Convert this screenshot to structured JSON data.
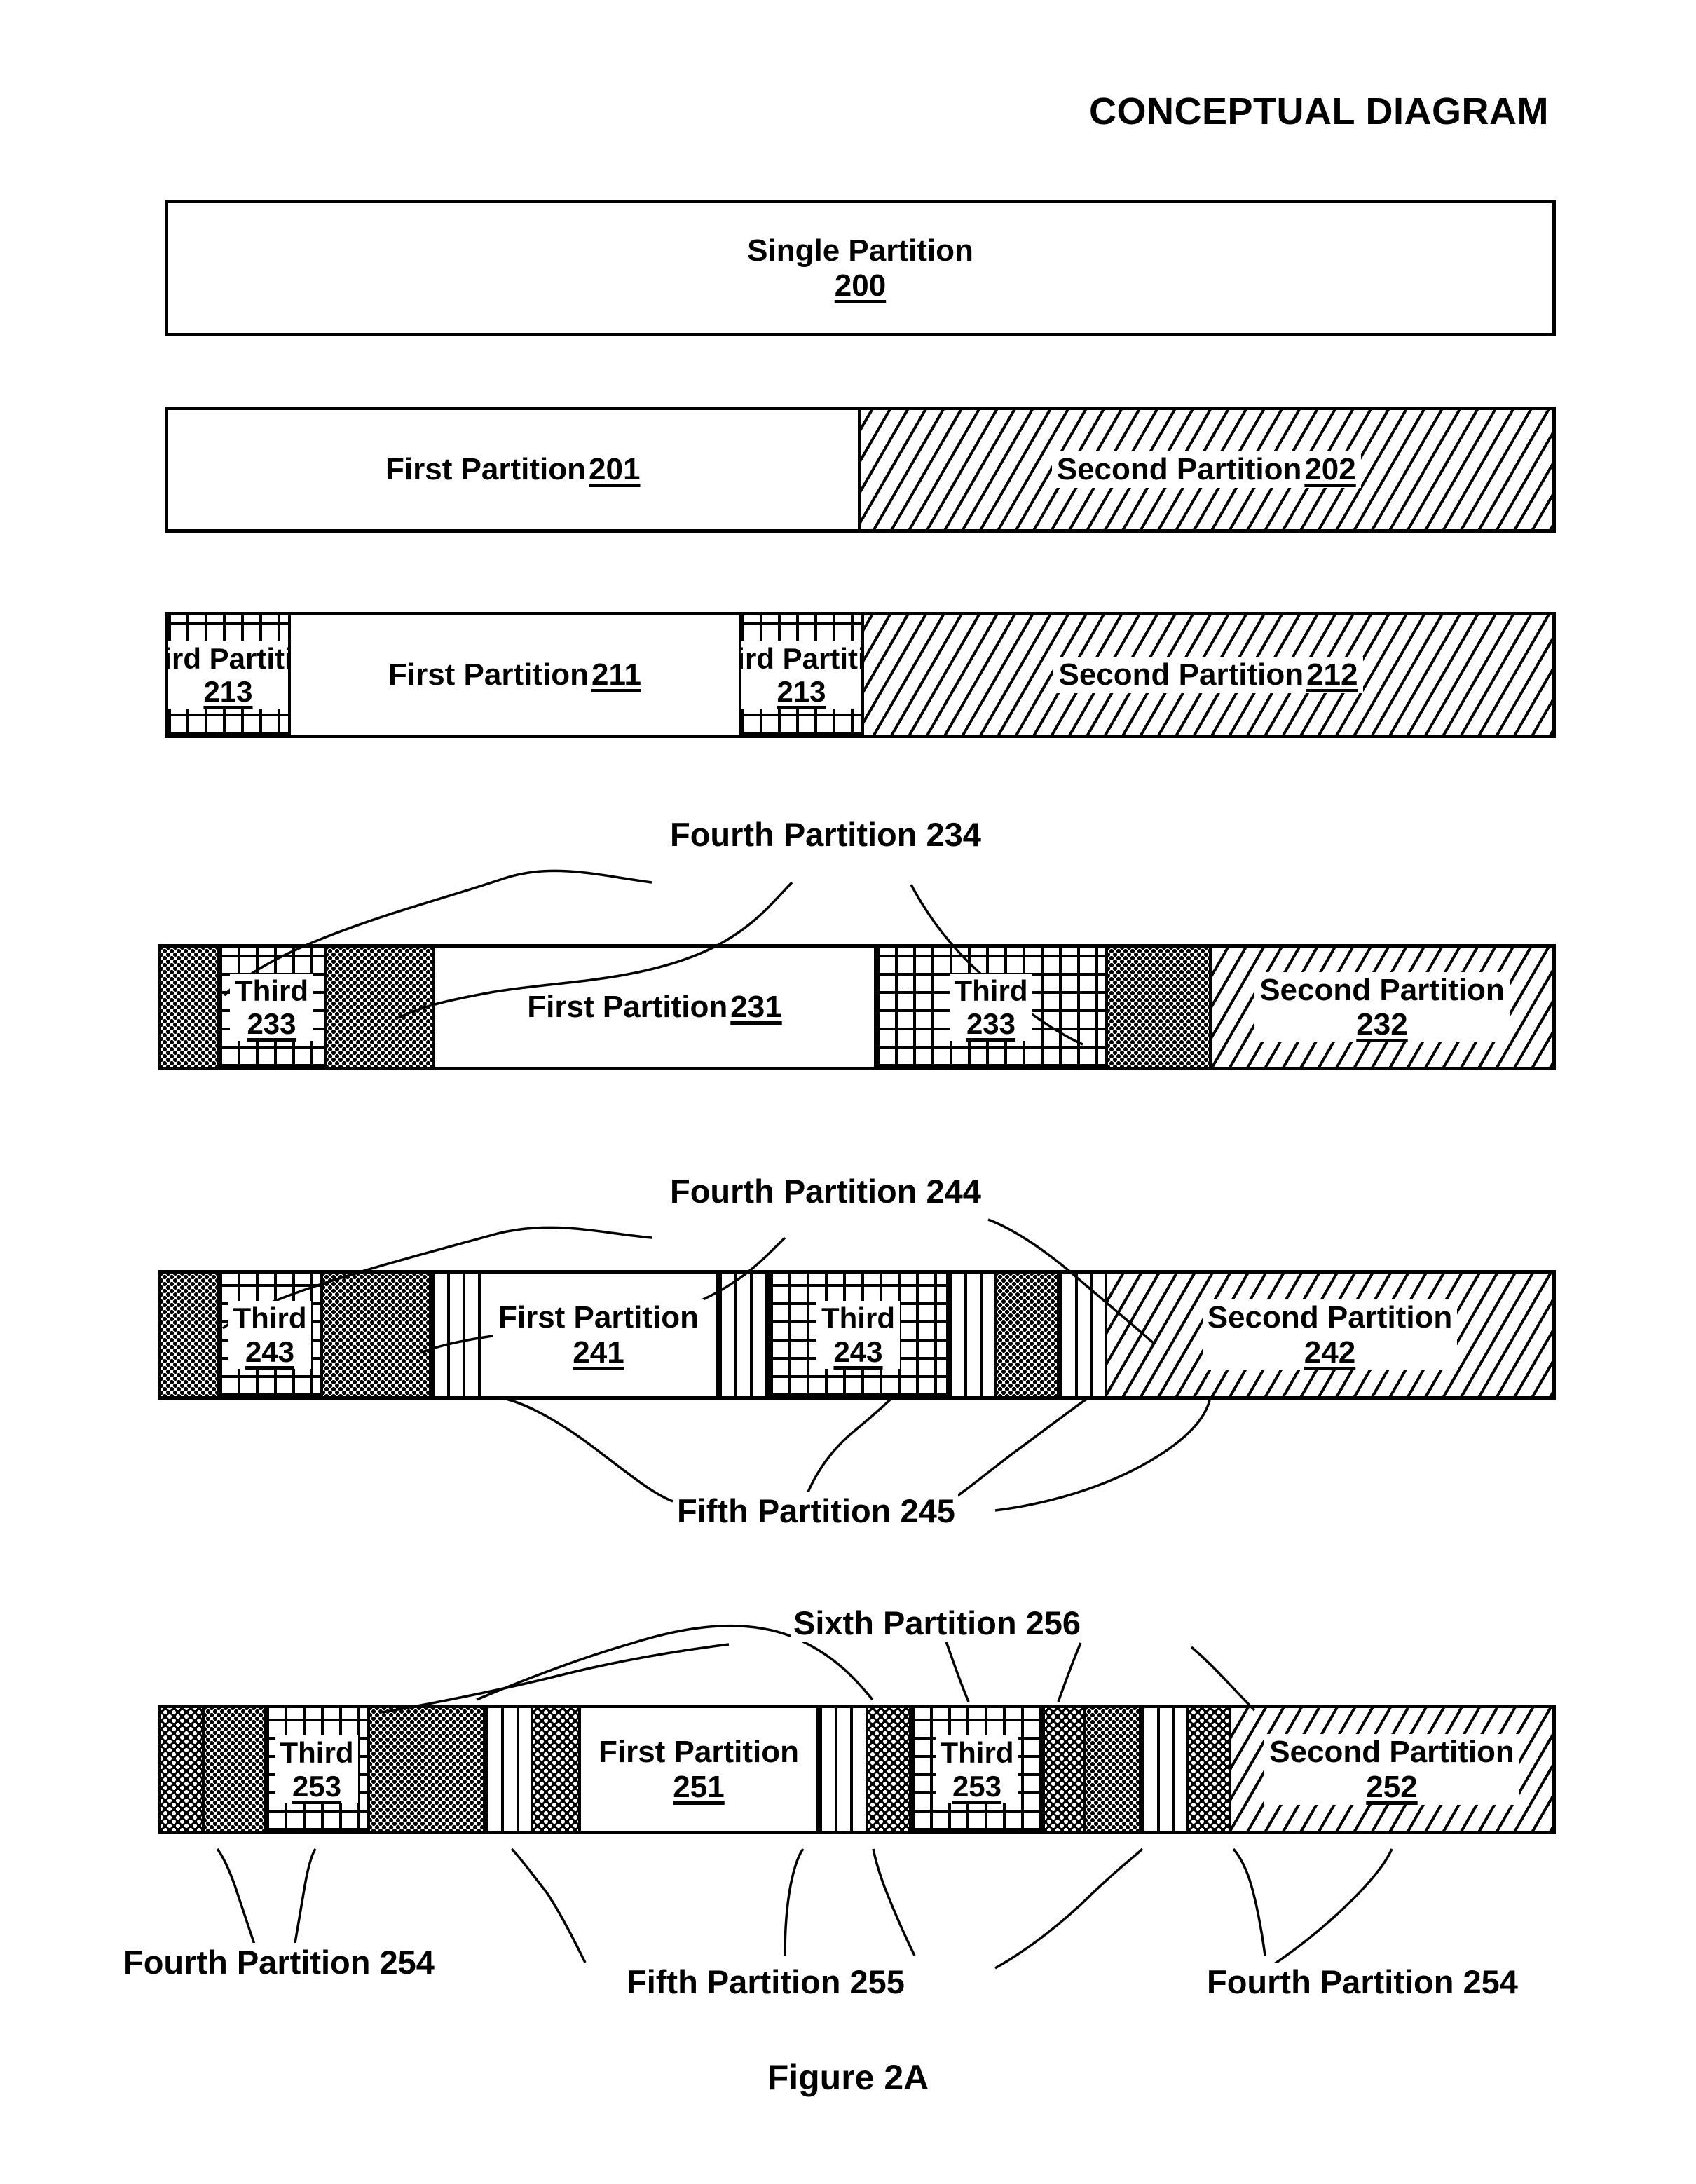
{
  "header": {
    "title": "CONCEPTUAL DIAGRAM"
  },
  "figure": {
    "caption": "Figure 2A"
  },
  "rows": [
    {
      "id": "row-1",
      "segments": [
        {
          "name": "single-partition",
          "label": "Single Partition",
          "num": "200",
          "layout": "stacked",
          "pattern": "none"
        }
      ]
    },
    {
      "id": "row-2",
      "segments": [
        {
          "name": "first-partition",
          "label": "First Partition",
          "num": "201",
          "layout": "inline",
          "pattern": "none"
        },
        {
          "name": "second-partition",
          "label": "Second Partition",
          "num": "202",
          "layout": "inline",
          "pattern": "diagonal"
        }
      ]
    },
    {
      "id": "row-3",
      "segments": [
        {
          "name": "third-partition",
          "label": "Third Partition",
          "num": "213",
          "layout": "stacked",
          "pattern": "grid"
        },
        {
          "name": "first-partition",
          "label": "First Partition",
          "num": "211",
          "layout": "inline",
          "pattern": "none"
        },
        {
          "name": "third-partition",
          "label": "Third Partition",
          "num": "213",
          "layout": "stacked",
          "pattern": "grid"
        },
        {
          "name": "second-partition",
          "label": "Second Partition",
          "num": "212",
          "layout": "inline",
          "pattern": "diagonal"
        }
      ]
    },
    {
      "id": "row-4",
      "segments": [
        {
          "name": "fourth-partition",
          "label": "",
          "num": "",
          "layout": "none",
          "pattern": "dots"
        },
        {
          "name": "third-partition",
          "label": "Third",
          "num": "233",
          "layout": "stacked",
          "pattern": "grid"
        },
        {
          "name": "fourth-partition",
          "label": "",
          "num": "",
          "layout": "none",
          "pattern": "dots"
        },
        {
          "name": "first-partition",
          "label": "First Partition",
          "num": "231",
          "layout": "inline",
          "pattern": "none"
        },
        {
          "name": "third-partition",
          "label": "Third",
          "num": "233",
          "layout": "stacked",
          "pattern": "grid"
        },
        {
          "name": "fourth-partition",
          "label": "",
          "num": "",
          "layout": "none",
          "pattern": "dots"
        },
        {
          "name": "second-partition",
          "label": "Second Partition",
          "num": "232",
          "layout": "stacked",
          "pattern": "diagonal"
        }
      ]
    },
    {
      "id": "row-5",
      "segments": [
        {
          "name": "fourth-partition",
          "label": "",
          "num": "",
          "layout": "none",
          "pattern": "dots"
        },
        {
          "name": "third-partition",
          "label": "Third",
          "num": "243",
          "layout": "stacked",
          "pattern": "grid"
        },
        {
          "name": "fourth-partition",
          "label": "",
          "num": "",
          "layout": "none",
          "pattern": "dots"
        },
        {
          "name": "fifth-partition",
          "label": "",
          "num": "",
          "layout": "none",
          "pattern": "vertical"
        },
        {
          "name": "first-partition",
          "label": "First Partition",
          "num": "241",
          "layout": "stacked",
          "pattern": "none"
        },
        {
          "name": "fifth-partition",
          "label": "",
          "num": "",
          "layout": "none",
          "pattern": "vertical"
        },
        {
          "name": "third-partition",
          "label": "Third",
          "num": "243",
          "layout": "stacked",
          "pattern": "grid"
        },
        {
          "name": "fifth-partition",
          "label": "",
          "num": "",
          "layout": "none",
          "pattern": "vertical"
        },
        {
          "name": "fourth-partition",
          "label": "",
          "num": "",
          "layout": "none",
          "pattern": "dots"
        },
        {
          "name": "fifth-partition",
          "label": "",
          "num": "",
          "layout": "none",
          "pattern": "vertical"
        },
        {
          "name": "second-partition",
          "label": "Second Partition",
          "num": "242",
          "layout": "stacked",
          "pattern": "diagonal"
        }
      ]
    },
    {
      "id": "row-6",
      "segments": [
        {
          "name": "sixth-partition",
          "label": "",
          "num": "",
          "layout": "none",
          "pattern": "dark"
        },
        {
          "name": "fourth-partition",
          "label": "",
          "num": "",
          "layout": "none",
          "pattern": "dots"
        },
        {
          "name": "third-partition",
          "label": "Third",
          "num": "253",
          "layout": "stacked",
          "pattern": "grid"
        },
        {
          "name": "fourth-partition",
          "label": "",
          "num": "",
          "layout": "none",
          "pattern": "dots"
        },
        {
          "name": "fifth-partition",
          "label": "",
          "num": "",
          "layout": "none",
          "pattern": "vertical"
        },
        {
          "name": "sixth-partition",
          "label": "",
          "num": "",
          "layout": "none",
          "pattern": "dark"
        },
        {
          "name": "first-partition",
          "label": "First Partition",
          "num": "251",
          "layout": "stacked",
          "pattern": "none"
        },
        {
          "name": "fifth-partition",
          "label": "",
          "num": "",
          "layout": "none",
          "pattern": "vertical"
        },
        {
          "name": "sixth-partition",
          "label": "",
          "num": "",
          "layout": "none",
          "pattern": "dark"
        },
        {
          "name": "third-partition",
          "label": "Third",
          "num": "253",
          "layout": "stacked",
          "pattern": "grid"
        },
        {
          "name": "sixth-partition",
          "label": "",
          "num": "",
          "layout": "none",
          "pattern": "dark"
        },
        {
          "name": "fourth-partition",
          "label": "",
          "num": "",
          "layout": "none",
          "pattern": "dots"
        },
        {
          "name": "fifth-partition",
          "label": "",
          "num": "",
          "layout": "none",
          "pattern": "vertical"
        },
        {
          "name": "sixth-partition",
          "label": "",
          "num": "",
          "layout": "none",
          "pattern": "dark"
        },
        {
          "name": "second-partition",
          "label": "Second Partition",
          "num": "252",
          "layout": "stacked",
          "pattern": "diagonal"
        }
      ]
    }
  ],
  "callouts": {
    "fourth_234": "Fourth Partition 234",
    "fourth_244": "Fourth Partition 244",
    "fifth_245": "Fifth Partition 245",
    "sixth_256": "Sixth Partition 256",
    "fourth_254_left": "Fourth Partition 254",
    "fifth_255": "Fifth Partition 255",
    "fourth_254_right": "Fourth Partition 254"
  }
}
